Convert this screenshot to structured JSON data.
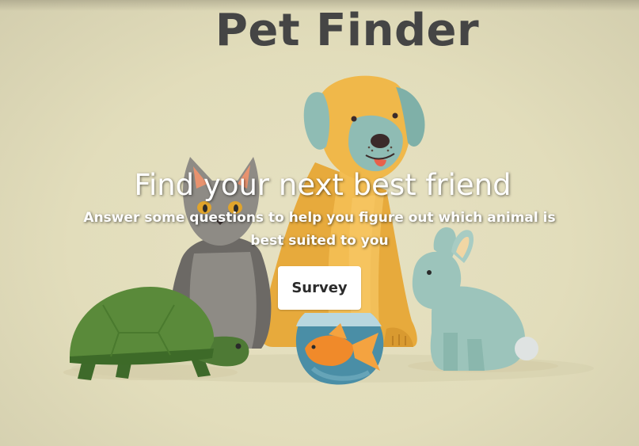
{
  "header": {
    "title": "Pet Finder"
  },
  "hero": {
    "heading": "Find your next best friend",
    "subheading": "Answer some questions to help you figure out which animal is best suited to you",
    "button_label": "Survey"
  },
  "colors": {
    "background": "#e2ddbb",
    "title_text": "#454545",
    "dog": "#f0b84a",
    "dog_face": "#8fbcb4",
    "cat": "#8e8b85",
    "turtle_shell": "#5a8a3a",
    "rabbit": "#9cc4bb",
    "fish": "#f08a2a",
    "bowl": "#4a8ea6"
  },
  "illustration": {
    "animals": [
      "dog-icon",
      "cat-icon",
      "turtle-icon",
      "goldfish-bowl-icon",
      "rabbit-icon"
    ]
  }
}
